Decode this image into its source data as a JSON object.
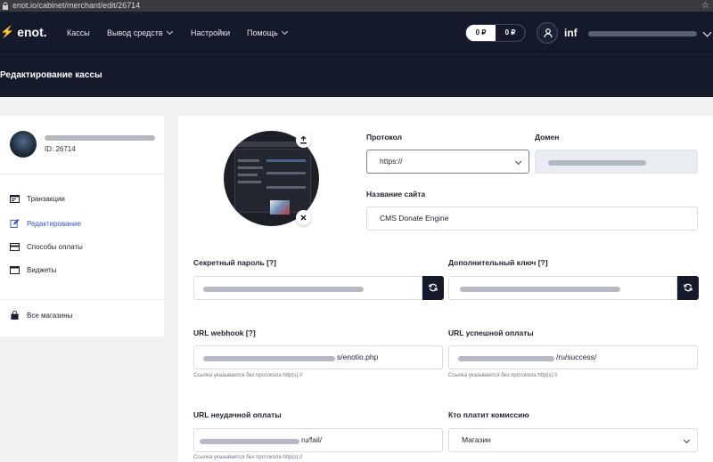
{
  "browser": {
    "url": "enot.io/cabinet/merchant/edit/26714"
  },
  "nav": {
    "logo": "enot.",
    "items": [
      {
        "label": "Кассы",
        "dropdown": false
      },
      {
        "label": "Вывод средств",
        "dropdown": true
      },
      {
        "label": "Настройки",
        "dropdown": false
      },
      {
        "label": "Помощь",
        "dropdown": true
      }
    ],
    "balance_1": "0 ₽",
    "balance_2": "0 ₽",
    "user_label": "inf"
  },
  "page": {
    "title": "Редактирование кассы"
  },
  "sidebar": {
    "shop_id": "ID: 26714",
    "items": [
      {
        "label": "Транзакции",
        "icon": "transactions-icon",
        "active": false
      },
      {
        "label": "Редактирование",
        "icon": "edit-icon",
        "active": true
      },
      {
        "label": "Способы оплаты",
        "icon": "card-icon",
        "active": false
      },
      {
        "label": "Виджеты",
        "icon": "widget-icon",
        "active": false
      }
    ],
    "all_shops": "Все магазины"
  },
  "form": {
    "protocol_label": "Протокол",
    "protocol_value": "https://",
    "domain_label": "Домен",
    "site_name_label": "Название сайта",
    "site_name_value": "CMS Donate Engine",
    "secret_label": "Секретный пароль [?]",
    "extra_key_label": "Дополнительный ключ [?]",
    "webhook_label": "URL webhook [?]",
    "webhook_value": "s/enotio.php",
    "success_label": "URL успешной оплаты",
    "success_value": "/ru/success/",
    "fail_label": "URL неудачной оплаты",
    "fail_value": "ru/fail/",
    "commission_label": "Кто платит комиссию",
    "commission_value": "Магазин",
    "hint": "Ссылка указывается без протокола http(s)://"
  },
  "colors": {
    "nav_bg": "#141a2b",
    "accent": "#2f56c8",
    "brand_bolt": "#f7c600"
  }
}
